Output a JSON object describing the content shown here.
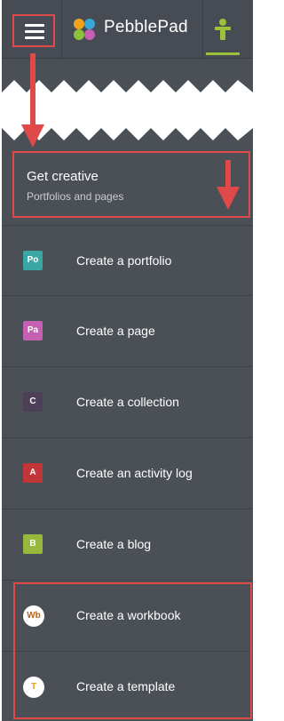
{
  "header": {
    "app_name": "PebblePad",
    "active_tab_color": "#9cc23c",
    "menu_icon": "hamburger-menu-icon",
    "logo_icon": "pebblepad-logo-icon",
    "user_icon": "person-icon"
  },
  "section": {
    "title": "Get creative",
    "subtitle": "Portfolios and pages"
  },
  "menu": {
    "items": [
      {
        "badge": "Po",
        "label": "Create a portfolio",
        "color": "#3aa7a4"
      },
      {
        "badge": "Pa",
        "label": "Create a page",
        "color": "#c45fb1"
      },
      {
        "badge": "C",
        "label": "Create a collection",
        "color": "#4e3f59"
      },
      {
        "badge": "A",
        "label": "Create an activity log",
        "color": "#c23538"
      },
      {
        "badge": "B",
        "label": "Create a blog",
        "color": "#97b83a"
      },
      {
        "badge": "Wb",
        "label": "Create a workbook",
        "color": "#b4641e"
      },
      {
        "badge": "T",
        "label": "Create a template",
        "color": "#e2a21b"
      }
    ]
  },
  "annotation_color": "#e04949"
}
